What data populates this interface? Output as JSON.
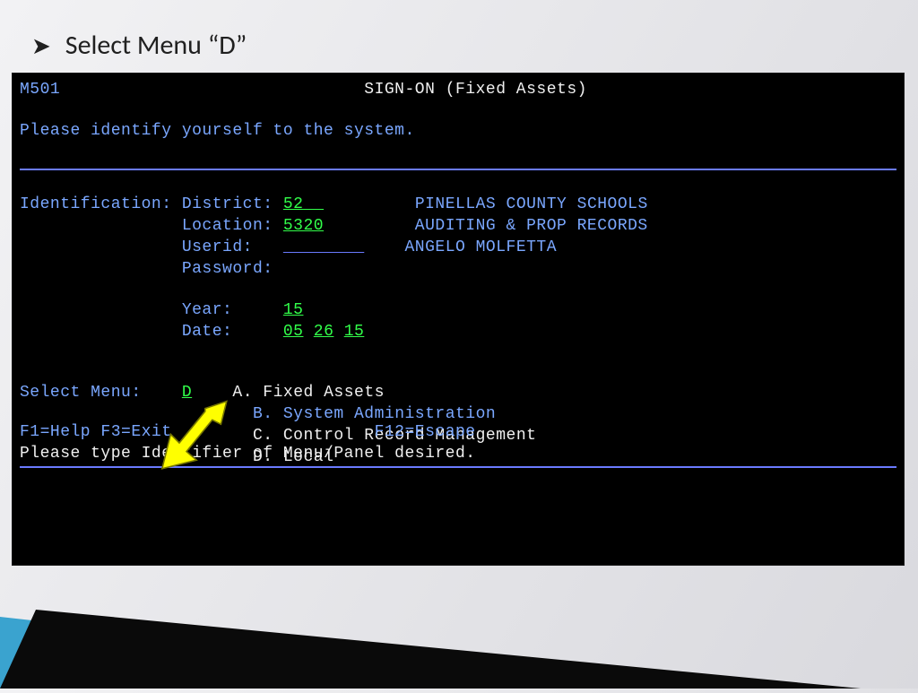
{
  "slide": {
    "bullet_text": "Select Menu “D”"
  },
  "terminal": {
    "screen_id": "M501",
    "title": "SIGN-ON (Fixed Assets)",
    "prompt": "Please identify yourself to the system.",
    "identification_label": "Identification:",
    "fields": {
      "district_label": "District:",
      "district_value": "52",
      "district_desc": "PINELLAS COUNTY SCHOOLS",
      "location_label": "Location:",
      "location_value": "5320",
      "location_desc": "AUDITING & PROP RECORDS",
      "userid_label": "Userid:",
      "userid_value": "",
      "userid_desc": "ANGELO MOLFETTA",
      "password_label": "Password:",
      "year_label": "Year:",
      "year_value": "15",
      "date_label": "Date:",
      "date_mm": "05",
      "date_dd": "26",
      "date_yy": "15"
    },
    "select_menu": {
      "label": "Select Menu:",
      "value": "D",
      "options": [
        {
          "key": "A",
          "text": "Fixed Assets",
          "style": "white"
        },
        {
          "key": "B",
          "text": "System Administration",
          "style": "cyan"
        },
        {
          "key": "C",
          "text": "Control Record Management",
          "style": "white"
        },
        {
          "key": "D",
          "text": "Local",
          "style": "white"
        }
      ]
    },
    "fkeys": {
      "left": "F1=Help F3=Exit",
      "right": "F12=Escape"
    },
    "hint": "Please type Identifier of Menu/Panel desired."
  }
}
